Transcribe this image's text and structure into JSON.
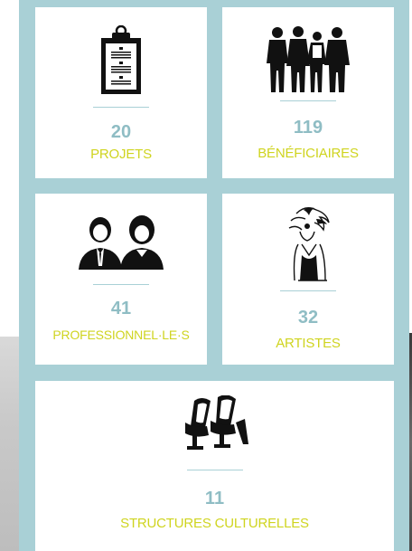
{
  "stats": [
    {
      "value": "20",
      "label": "PROJETS",
      "icon": "clipboard-icon"
    },
    {
      "value": "119",
      "label": "BÉNÉFICIAIRES",
      "icon": "people-group-icon"
    },
    {
      "value": "41",
      "label": "PROFESSIONNEL·LE·S",
      "icon": "professionals-icon"
    },
    {
      "value": "32",
      "label": "ARTISTES",
      "icon": "artist-icon"
    },
    {
      "value": "11",
      "label": "STRUCTURES CULTURELLES",
      "icon": "theater-seats-icon"
    }
  ],
  "colors": {
    "panel": "#a9d0d6",
    "number": "#8fbdc4",
    "label": "#cfd41f"
  }
}
